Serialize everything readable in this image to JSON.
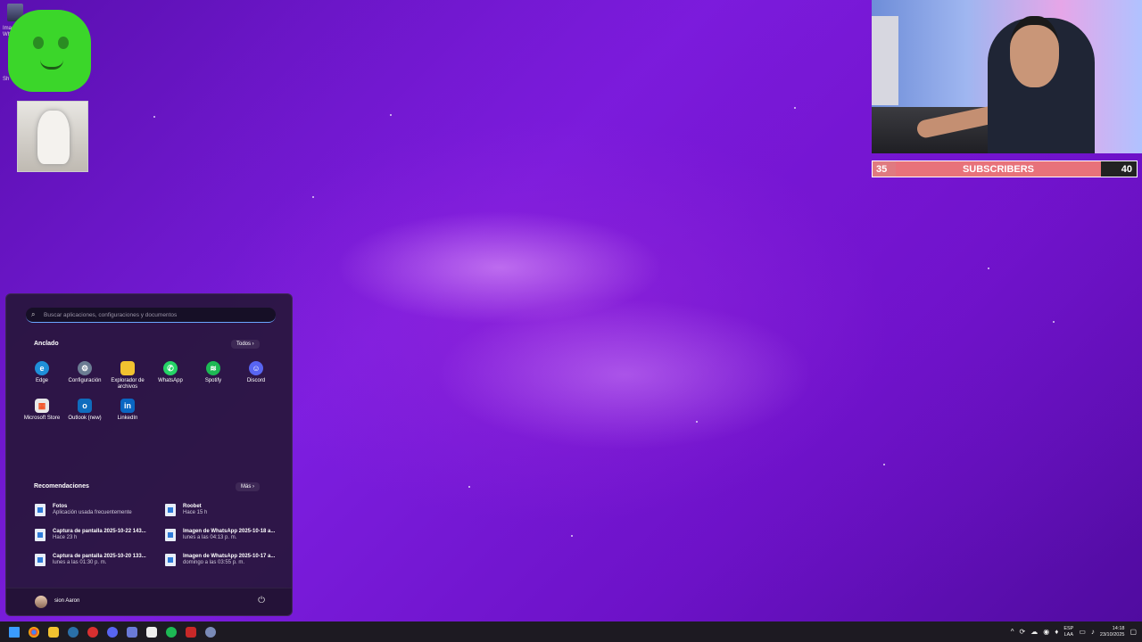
{
  "desktop": {
    "icon1_label": "Imag",
    "icon1_sub": "Wha",
    "icon2_label": "Sh"
  },
  "overlay": {
    "subs_left": "35",
    "subs_label": "SUBSCRIBERS",
    "subs_right": "40"
  },
  "start_menu": {
    "search_placeholder": "Buscar aplicaciones, configuraciones y documentos",
    "pinned_title": "Anclado",
    "all_button": "Todos  ›",
    "pinned": [
      {
        "label": "Edge",
        "icon": "edge-icon",
        "color": "#1f8fd8"
      },
      {
        "label": "Configuración",
        "icon": "gear-icon",
        "color": "#6b7c93"
      },
      {
        "label": "Explorador de archivos",
        "icon": "folder-icon",
        "color": "#f2c230"
      },
      {
        "label": "WhatsApp",
        "icon": "whatsapp-icon",
        "color": "#25d366"
      },
      {
        "label": "Spotify",
        "icon": "spotify-icon",
        "color": "#1db954"
      },
      {
        "label": "Discord",
        "icon": "discord-icon",
        "color": "#5865f2"
      },
      {
        "label": "Microsoft Store",
        "icon": "store-icon",
        "color": "#e8e8e8"
      },
      {
        "label": "Outlook (new)",
        "icon": "outlook-icon",
        "color": "#0f6cbd"
      },
      {
        "label": "LinkedIn",
        "icon": "linkedin-icon",
        "color": "#0a66c2"
      }
    ],
    "recommended_title": "Recomendaciones",
    "more_button": "Más  ›",
    "recommended": [
      {
        "title": "Fotos",
        "sub": "Aplicación usada frecuentemente"
      },
      {
        "title": "Roobet",
        "sub": "Hace 15 h"
      },
      {
        "title": "Captura de pantalla 2025-10-22 143...",
        "sub": "Hace 23 h"
      },
      {
        "title": "Imagen de WhatsApp 2025-10-18 a...",
        "sub": "lunes a las 04:13 p. m."
      },
      {
        "title": "Captura de pantalla 2025-10-20 133...",
        "sub": "lunes a las 01:30 p. m."
      },
      {
        "title": "Imagen de WhatsApp 2025-10-17 a...",
        "sub": "domingo a las 03:55 p. m."
      }
    ],
    "user_name": "sion Aaron"
  },
  "taskbar": {
    "lang_top": "ESP",
    "lang_bottom": "LAA",
    "time": "14:18",
    "date": "23/10/2025"
  }
}
